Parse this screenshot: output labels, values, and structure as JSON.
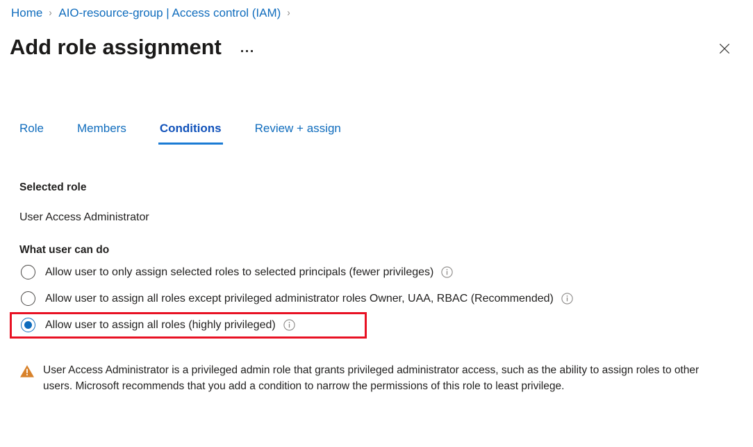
{
  "breadcrumb": {
    "items": [
      {
        "label": "Home"
      },
      {
        "label": "AIO-resource-group | Access control (IAM)"
      }
    ],
    "separator": "›"
  },
  "header": {
    "title": "Add role assignment",
    "more_label": "More commands",
    "close_label": "Close"
  },
  "tabs": [
    {
      "label": "Role",
      "active": false
    },
    {
      "label": "Members",
      "active": false
    },
    {
      "label": "Conditions",
      "active": true
    },
    {
      "label": "Review + assign",
      "active": false
    }
  ],
  "selected_role": {
    "heading": "Selected role",
    "value": "User Access Administrator"
  },
  "what_user_can_do": {
    "heading": "What user can do",
    "options": [
      {
        "label": "Allow user to only assign selected roles to selected principals (fewer privileges)",
        "checked": false,
        "info": "info-icon"
      },
      {
        "label": "Allow user to assign all roles except privileged administrator roles Owner, UAA, RBAC (Recommended)",
        "checked": false,
        "info": "info-icon"
      },
      {
        "label": "Allow user to assign all roles (highly privileged)",
        "checked": true,
        "info": "info-icon",
        "highlighted": true
      }
    ]
  },
  "warning": {
    "text": "User Access Administrator is a privileged admin role that grants privileged administrator access, such as the ability to assign roles to other users. Microsoft recommends that you add a condition to narrow the permissions of this role to least privilege.",
    "icon": "warning-triangle-icon"
  },
  "colors": {
    "link": "#0f6cbd",
    "active_tab": "#1152ba",
    "tab_underline": "#1a7bd4",
    "annotation": "#e81123",
    "warning": "#d8822b",
    "text": "#201f1e"
  }
}
